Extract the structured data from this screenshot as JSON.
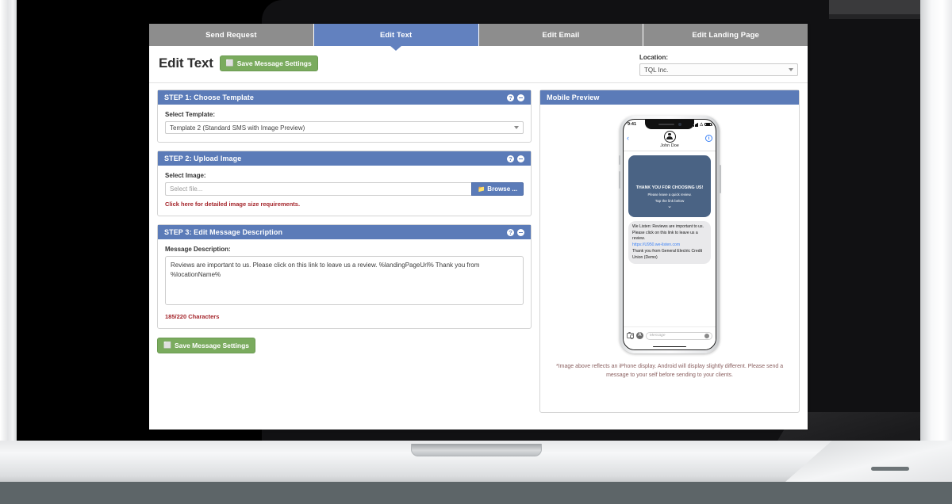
{
  "tabs": [
    {
      "label": "Send Request",
      "active": false
    },
    {
      "label": "Edit Text",
      "active": true
    },
    {
      "label": "Edit Email",
      "active": false
    },
    {
      "label": "Edit Landing Page",
      "active": false
    }
  ],
  "header": {
    "title": "Edit Text",
    "save_label": "Save Message Settings",
    "save_glyph": "⬜",
    "location_label": "Location:",
    "location_value": "TQL Inc."
  },
  "panels": {
    "step1": {
      "title": "STEP 1: Choose Template",
      "help_icon": "?",
      "field_label": "Select Template:",
      "selected": "Template 2 (Standard SMS with Image Preview)"
    },
    "step2": {
      "title": "STEP 2: Upload Image",
      "help_icon": "?",
      "field_label": "Select Image:",
      "file_placeholder": "Select file...",
      "browse_label": "Browse ...",
      "browse_glyph": "📁",
      "requirements_link": "Click here for detailed image size requirements."
    },
    "step3": {
      "title": "STEP 3: Edit Message Description",
      "help_icon": "?",
      "field_label": "Message Description:",
      "message_value": "Reviews are important to us. Please click on this link to leave us a review. %landingPageUrl% Thank you from %locationName%",
      "char_count": "185/220 Characters"
    }
  },
  "footer_save_label": "Save Message Settings",
  "preview": {
    "title": "Mobile Preview",
    "phone": {
      "status_time": "9:41",
      "contact_name": "John Doe",
      "back_icon": "‹",
      "info_icon": "i",
      "mms_line1": "THANK YOU FOR CHOOSING US!",
      "mms_line2": "Please leave a quick review.",
      "mms_line3": "Tap the link below",
      "mms_chevron": "⌄",
      "bubble_text1": "We Listen: Reviews are important to us. Please click on this link to leave us a review.",
      "bubble_link": "https://U950.we-listen.com",
      "bubble_text2": "Thank you from General Electric Credit Union (Demo)",
      "input_placeholder": "Message"
    },
    "note": "*Image above reflects an iPhone display. Android will display slightly different. Please send a message to your self before sending to your clients."
  },
  "colors": {
    "accent_blue": "#5b7bb8",
    "tab_active": "#6281bf",
    "tab_inactive": "#8d8d8d",
    "save_green": "#7aab5e",
    "alert_red": "#a4242a",
    "mms_card": "#4a6384"
  }
}
